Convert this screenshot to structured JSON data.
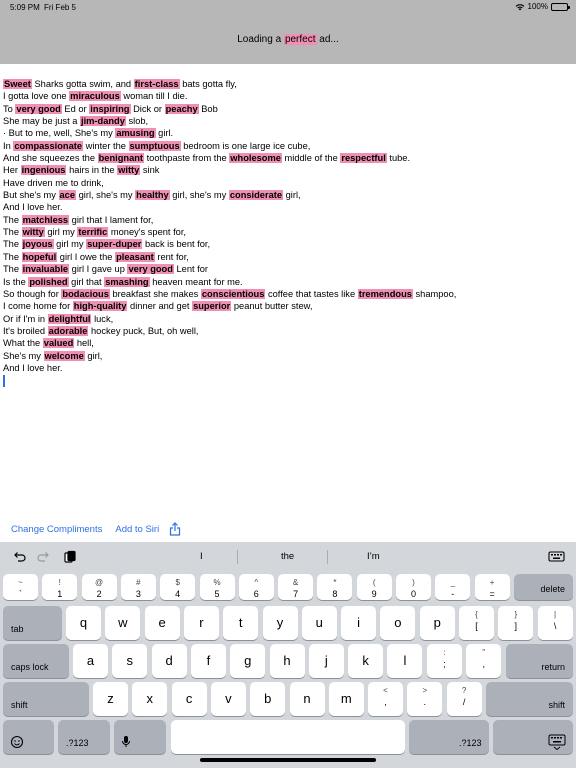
{
  "status": {
    "time": "5:09 PM",
    "date": "Fri Feb 5",
    "battery": "100%"
  },
  "ad": {
    "before": "Loading a ",
    "highlight": "perfect",
    "after": " ad..."
  },
  "poem": [
    [
      {
        "t": "Sweet",
        "h": true
      },
      {
        "t": " Sharks gotta swim, and "
      },
      {
        "t": "first-class",
        "h": true
      },
      {
        "t": " bats gotta fly,"
      }
    ],
    [
      {
        "t": "I gotta love one "
      },
      {
        "t": "miraculous",
        "h": true
      },
      {
        "t": " woman till I die."
      }
    ],
    [
      {
        "t": "To "
      },
      {
        "t": "very good",
        "h": true
      },
      {
        "t": " Ed or "
      },
      {
        "t": "inspiring",
        "h": true
      },
      {
        "t": " Dick or "
      },
      {
        "t": "peachy",
        "h": true
      },
      {
        "t": " Bob"
      }
    ],
    [
      {
        "t": "She may be just a "
      },
      {
        "t": "jim-dandy",
        "h": true
      },
      {
        "t": " slob,"
      }
    ],
    [
      {
        "t": "· But to me, well, She's my "
      },
      {
        "t": "amusing",
        "h": true
      },
      {
        "t": " girl."
      }
    ],
    [
      {
        "t": "In "
      },
      {
        "t": "compassionate",
        "h": true
      },
      {
        "t": " winter the "
      },
      {
        "t": "sumptuous",
        "h": true
      },
      {
        "t": " bedroom is one large ice cube,"
      }
    ],
    [
      {
        "t": "And she squeezes the "
      },
      {
        "t": "benignant",
        "h": true
      },
      {
        "t": " toothpaste from the "
      },
      {
        "t": "wholesome",
        "h": true
      },
      {
        "t": " middle of the "
      },
      {
        "t": "respectful",
        "h": true
      },
      {
        "t": " tube."
      }
    ],
    [
      {
        "t": "Her "
      },
      {
        "t": "ingenious",
        "h": true
      },
      {
        "t": " hairs in the "
      },
      {
        "t": "witty",
        "h": true
      },
      {
        "t": " sink"
      }
    ],
    [
      {
        "t": "Have driven me to drink,"
      }
    ],
    [
      {
        "t": "But she's my "
      },
      {
        "t": "ace",
        "h": true
      },
      {
        "t": " girl, she's my "
      },
      {
        "t": "healthy",
        "h": true
      },
      {
        "t": " girl, she's my "
      },
      {
        "t": "considerate",
        "h": true
      },
      {
        "t": " girl,"
      }
    ],
    [
      {
        "t": "And I love her."
      }
    ],
    [
      {
        "t": "The "
      },
      {
        "t": "matchless",
        "h": true
      },
      {
        "t": " girl that I lament for,"
      }
    ],
    [
      {
        "t": "The "
      },
      {
        "t": "witty",
        "h": true
      },
      {
        "t": " girl my "
      },
      {
        "t": "terrific",
        "h": true
      },
      {
        "t": " money's spent for,"
      }
    ],
    [
      {
        "t": "The "
      },
      {
        "t": "joyous",
        "h": true
      },
      {
        "t": " girl my "
      },
      {
        "t": "super-duper",
        "h": true
      },
      {
        "t": " back is bent for,"
      }
    ],
    [
      {
        "t": "The "
      },
      {
        "t": "hopeful",
        "h": true
      },
      {
        "t": " girl I owe the "
      },
      {
        "t": "pleasant",
        "h": true
      },
      {
        "t": " rent for,"
      }
    ],
    [
      {
        "t": "The "
      },
      {
        "t": "invaluable",
        "h": true
      },
      {
        "t": " girl I gave up "
      },
      {
        "t": "very good",
        "h": true
      },
      {
        "t": " Lent for"
      }
    ],
    [
      {
        "t": "Is the "
      },
      {
        "t": "polished",
        "h": true
      },
      {
        "t": " girl that "
      },
      {
        "t": "smashing",
        "h": true
      },
      {
        "t": " heaven meant for me."
      }
    ],
    [
      {
        "t": "So though for "
      },
      {
        "t": "bodacious",
        "h": true
      },
      {
        "t": " breakfast she makes "
      },
      {
        "t": "conscientious",
        "h": true
      },
      {
        "t": " coffee that tastes like "
      },
      {
        "t": "tremendous",
        "h": true
      },
      {
        "t": " shampoo,"
      }
    ],
    [
      {
        "t": "I come home for "
      },
      {
        "t": "high-quality",
        "h": true
      },
      {
        "t": " dinner and get "
      },
      {
        "t": "superior",
        "h": true
      },
      {
        "t": " peanut butter stew,"
      }
    ],
    [
      {
        "t": "Or if I'm in "
      },
      {
        "t": "delightful",
        "h": true
      },
      {
        "t": " luck,"
      }
    ],
    [
      {
        "t": "It's broiled "
      },
      {
        "t": "adorable",
        "h": true
      },
      {
        "t": " hockey puck, But, oh well,"
      }
    ],
    [
      {
        "t": "What the "
      },
      {
        "t": "valued",
        "h": true
      },
      {
        "t": " hell,"
      }
    ],
    [
      {
        "t": "She's my "
      },
      {
        "t": "welcome",
        "h": true
      },
      {
        "t": " girl,"
      }
    ],
    [
      {
        "t": "And I love her."
      }
    ]
  ],
  "accessory": {
    "change": "Change Compliments",
    "siri": "Add to Siri"
  },
  "suggestions": [
    "I",
    "the",
    "I’m"
  ],
  "keyboard": {
    "row1": [
      {
        "top": "~",
        "bot": "`"
      },
      {
        "top": "!",
        "bot": "1"
      },
      {
        "top": "@",
        "bot": "2"
      },
      {
        "top": "#",
        "bot": "3"
      },
      {
        "top": "$",
        "bot": "4"
      },
      {
        "top": "%",
        "bot": "5"
      },
      {
        "top": "^",
        "bot": "6"
      },
      {
        "top": "&",
        "bot": "7"
      },
      {
        "top": "*",
        "bot": "8"
      },
      {
        "top": "(",
        "bot": "9"
      },
      {
        "top": ")",
        "bot": "0"
      },
      {
        "top": "_",
        "bot": "-"
      },
      {
        "top": "+",
        "bot": "="
      }
    ],
    "delete": "delete",
    "tab": "tab",
    "row2": [
      "q",
      "w",
      "e",
      "r",
      "t",
      "y",
      "u",
      "i",
      "o",
      "p"
    ],
    "row2_extra": [
      {
        "top": "{",
        "bot": "["
      },
      {
        "top": "}",
        "bot": "]"
      },
      {
        "top": "|",
        "bot": "\\"
      }
    ],
    "caps": "caps lock",
    "row3": [
      "a",
      "s",
      "d",
      "f",
      "g",
      "h",
      "j",
      "k",
      "l"
    ],
    "row3_extra": [
      {
        "top": ":",
        "bot": ";"
      },
      {
        "top": "\"",
        "bot": ","
      }
    ],
    "return": "return",
    "shift": "shift",
    "row4": [
      "z",
      "x",
      "c",
      "v",
      "b",
      "n",
      "m"
    ],
    "row4_extra": [
      {
        "top": "<",
        "bot": ","
      },
      {
        "top": ">",
        "bot": "."
      },
      {
        "top": "?",
        "bot": "/"
      }
    ],
    "numbers": ".?123"
  }
}
